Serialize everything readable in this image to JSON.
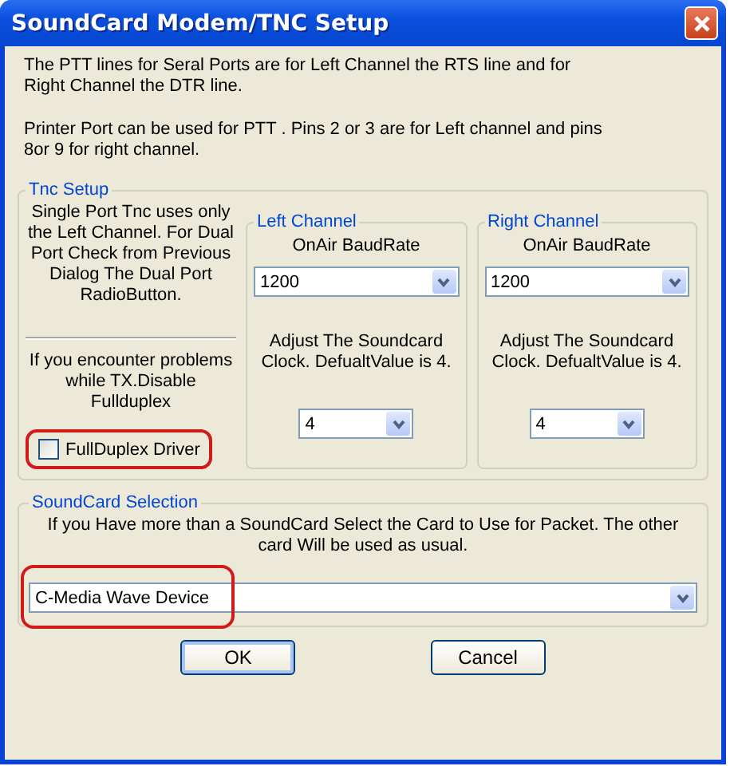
{
  "window": {
    "title": "SoundCard Modem/TNC Setup"
  },
  "intro": [
    "The PTT lines for Seral Ports are for Left Channel the RTS line and for\nRight Channel the DTR line.",
    "Printer Port can be used for PTT . Pins 2 or 3 are for Left channel and pins\n8or 9 for right channel."
  ],
  "tnc_setup": {
    "title": "Tnc Setup",
    "single_port_note": "Single Port Tnc uses only the Left Channel. For Dual Port Check from Previous Dialog The Dual Port RadioButton.",
    "problem_note": "If you encounter problems while TX.Disable Fullduplex",
    "full_duplex": {
      "label": "FullDuplex Driver",
      "checked": false,
      "highlighted": true
    },
    "channels": [
      {
        "title": "Left Channel",
        "baud_label": "OnAir BaudRate",
        "baud_rate": "1200",
        "clock_note": "Adjust The Soundcard Clock. DefualtValue is 4.",
        "clock_value": "4"
      },
      {
        "title": "Right Channel",
        "baud_label": "OnAir BaudRate",
        "baud_rate": "1200",
        "clock_note": "Adjust The Soundcard Clock. DefualtValue is 4.",
        "clock_value": "4"
      }
    ]
  },
  "soundcard_selection": {
    "title": "SoundCard Selection",
    "note": "If you Have more than a SoundCard Select the Card to Use for Packet. The other card Will be used as usual.",
    "device": "C-Media Wave Device",
    "highlighted": true
  },
  "buttons": [
    {
      "label": "OK",
      "default": true
    },
    {
      "label": "Cancel",
      "default": false
    }
  ]
}
